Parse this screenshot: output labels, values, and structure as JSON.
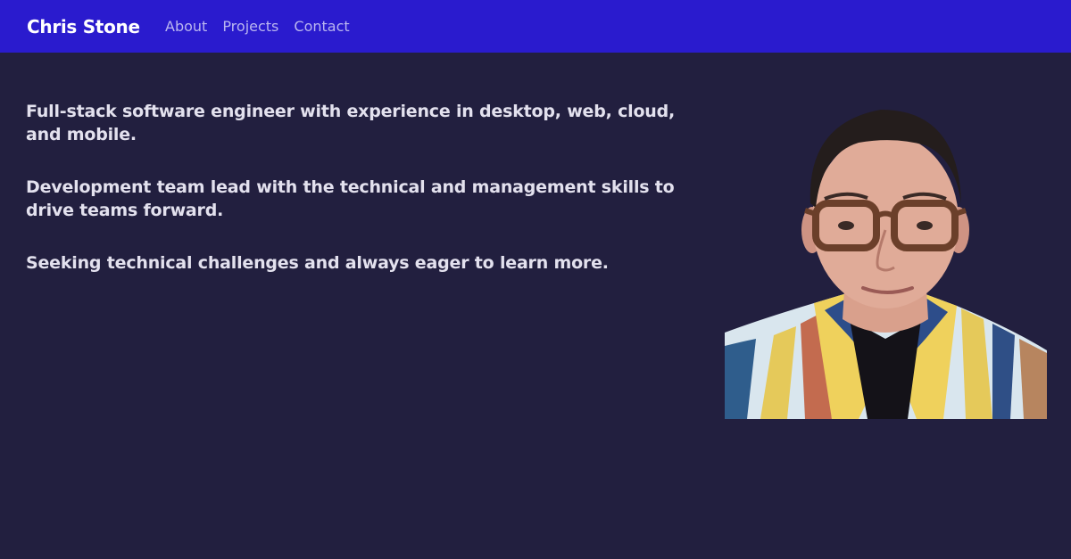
{
  "header": {
    "brand": "Chris Stone",
    "nav": [
      {
        "label": "About"
      },
      {
        "label": "Projects"
      },
      {
        "label": "Contact"
      }
    ]
  },
  "main": {
    "paragraphs": [
      "Full-stack software engineer with experience in desktop, web, cloud, and mobile.",
      "Development team lead with the technical and management skills to drive teams forward.",
      "Seeking technical challenges and always eager to learn more."
    ]
  },
  "colors": {
    "background": "#221f3f",
    "navbar": "#2a1bce",
    "brand_text": "#ffffff",
    "nav_link": "#b9b5f0",
    "body_text": "#e3e1ee"
  }
}
